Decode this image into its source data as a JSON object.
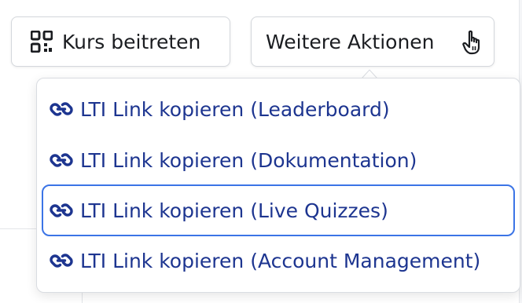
{
  "toolbar": {
    "join_course_label": "Kurs beitreten",
    "more_actions_label": "Weitere Aktionen"
  },
  "dropdown": {
    "items": [
      {
        "label": "LTI Link kopieren (Leaderboard)",
        "icon": "link-icon"
      },
      {
        "label": "LTI Link kopieren (Dokumentation)",
        "icon": "link-icon"
      },
      {
        "label": "LTI Link kopieren (Live Quizzes)",
        "icon": "link-icon",
        "focused": true
      },
      {
        "label": "LTI Link kopieren (Account Management)",
        "icon": "link-icon"
      }
    ]
  },
  "colors": {
    "link_text": "#1d3590",
    "focus_ring": "#3b74e6",
    "button_text": "#1b1d21"
  }
}
